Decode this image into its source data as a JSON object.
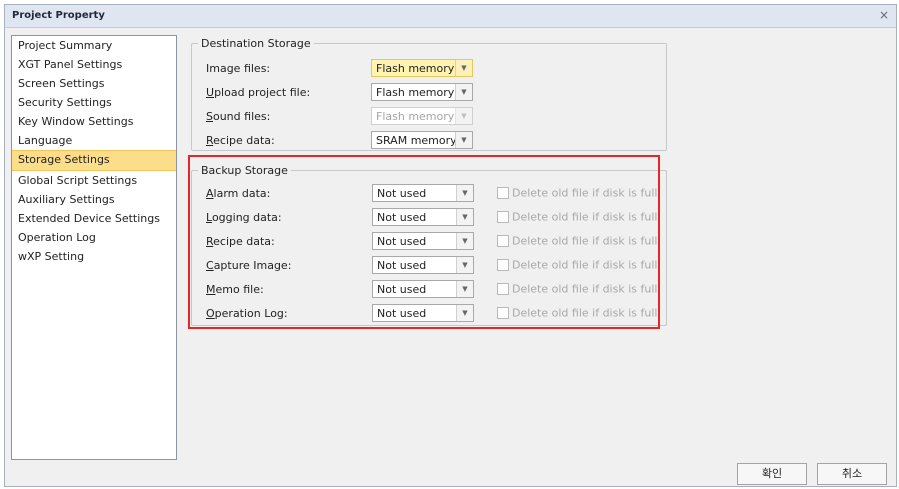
{
  "window": {
    "title": "Project Property",
    "close_label": "×"
  },
  "sidebar": {
    "items": [
      {
        "label": "Project Summary"
      },
      {
        "label": "XGT Panel Settings"
      },
      {
        "label": "Screen Settings"
      },
      {
        "label": "Security Settings"
      },
      {
        "label": "Key Window Settings"
      },
      {
        "label": "Language"
      },
      {
        "label": "Storage Settings",
        "selected": true
      },
      {
        "label": "Global Script Settings"
      },
      {
        "label": "Auxiliary Settings"
      },
      {
        "label": "Extended Device Settings"
      },
      {
        "label": "Operation Log"
      },
      {
        "label": "wXP Setting"
      }
    ]
  },
  "destination": {
    "legend": "Destination Storage",
    "rows": [
      {
        "label_pre": "Image files:",
        "label_u": "",
        "label_post": "",
        "value": "Flash memory",
        "state": "highlight"
      },
      {
        "label_pre": "",
        "label_u": "U",
        "label_post": "pload project file:",
        "value": "Flash memory",
        "state": "normal"
      },
      {
        "label_pre": "",
        "label_u": "S",
        "label_post": "ound files:",
        "value": "Flash memory",
        "state": "disabled"
      },
      {
        "label_pre": "",
        "label_u": "R",
        "label_post": "ecipe data:",
        "value": "SRAM memory",
        "state": "normal"
      }
    ]
  },
  "backup": {
    "legend": "Backup Storage",
    "checkbox_label": "Delete old file if disk is full",
    "rows": [
      {
        "label_u": "A",
        "label_post": "larm data:",
        "value": "Not used"
      },
      {
        "label_u": "L",
        "label_post": "ogging data:",
        "value": "Not used"
      },
      {
        "label_u": "R",
        "label_post": "ecipe data:",
        "value": "Not used"
      },
      {
        "label_u": "C",
        "label_post": "apture Image:",
        "value": "Not used"
      },
      {
        "label_u": "M",
        "label_post": "emo file:",
        "value": "Not used"
      },
      {
        "label_u": "O",
        "label_post": "peration Log:",
        "value": "Not used"
      }
    ]
  },
  "footer": {
    "ok_label": "확인",
    "cancel_label": "취소"
  },
  "colors": {
    "highlight_box": "#e5252a",
    "selected_item": "#fcdd8a"
  }
}
